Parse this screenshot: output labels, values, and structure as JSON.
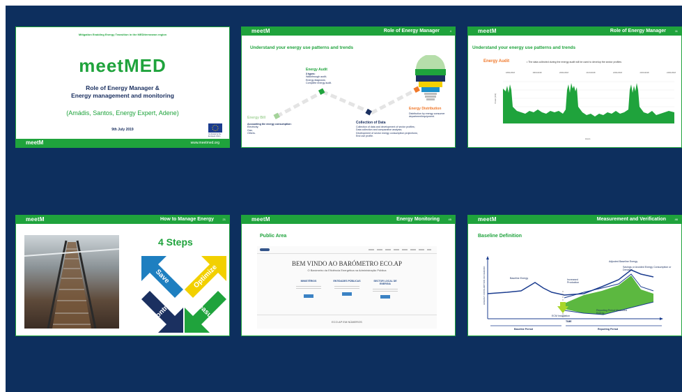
{
  "logo": "meetM",
  "slides": [
    {
      "banner": "Mitigation Enabling Energy Transition in the MEDiterranean region",
      "big_logo": "meetMED",
      "title_line1": "Role of Energy Manager &",
      "title_line2": "Energy management and monitoring",
      "authors": "(Amádis, Santos, Energy Expert, Adene)",
      "date": "9th July 2019",
      "eu_text": "Co-funded by the European Union",
      "url": "www.meetmed.org"
    },
    {
      "title": "Role of Energy Manager",
      "page": "4",
      "heading": "Understand your energy use patterns and trends",
      "steps": {
        "audit": {
          "label": "Energy Audit",
          "intro": "3 types:",
          "items": [
            "Walkthrough audit;",
            "Energy diagnosis;",
            "Complete energy audit."
          ]
        },
        "bill": {
          "label": "Energy Bill",
          "intro": "Accounting the energy consumption:",
          "items": [
            "Electricity;",
            "Gas;",
            "Others."
          ]
        },
        "data": {
          "label": "Collection of Data",
          "items": [
            "Collection of data and development of sector profiles;",
            "Data collection and comparative analysis;",
            "Development of sector energy consumption projections;",
            "End use profile."
          ]
        },
        "dist": {
          "label": "Energy Distribution",
          "items": [
            "Distribution by energy consumer department/equipment."
          ]
        }
      }
    },
    {
      "title": "Role of Energy Manager",
      "page": "11",
      "heading": "Understand your energy use patterns and trends",
      "audit_label": "Energy Audit",
      "bullet": "The data collected during the energy audit will be used to develop the sector profiles",
      "chart_dates": [
        "18/01/2018",
        "18/01/2018",
        "20/01/2018",
        "21/01/2018",
        "22/01/2018",
        "23/01/2018",
        "24/01/2018"
      ],
      "ylabel": "Power (kW)",
      "xlabel": "Hours"
    },
    {
      "title": "How to Manage Energy",
      "page": "21",
      "steps_title": "4 Steps",
      "arrows": [
        "Save",
        "Optimize",
        "Control",
        "Measure"
      ]
    },
    {
      "title": "Energy Monitoring",
      "page": "45",
      "heading": "Public Area",
      "site_title": "BEM VINDO AO BARÓMETRO ECO.AP",
      "site_subtitle": "O Barómetro da Eficiência Energética na Administração Pública",
      "cards": [
        "MINISTÉRIOS",
        "ENTIDADES PÚBLICAS",
        "SECTOR LOCAL DE ENERGIA"
      ],
      "footer": "ECO.AP EM NÚMEROS"
    },
    {
      "title": "Measurement and Verification",
      "page": "46",
      "heading": "Baseline Definition",
      "labels": {
        "baseline": "Baseline Energy",
        "adjusted": "Adjusted Baseline Energy",
        "savings": "Savings or Avoided Energy Consumption or Demand",
        "increased": "Increased Production",
        "reporting_energy": "Reporting Period Measured Energy",
        "ecm": "ECM Installation",
        "time": "TIME",
        "baseline_period": "Baseline Period",
        "reporting_period": "Reporting Period",
        "yaxis": "ENERGY CONSUMPTION OR DEMAND"
      }
    }
  ]
}
